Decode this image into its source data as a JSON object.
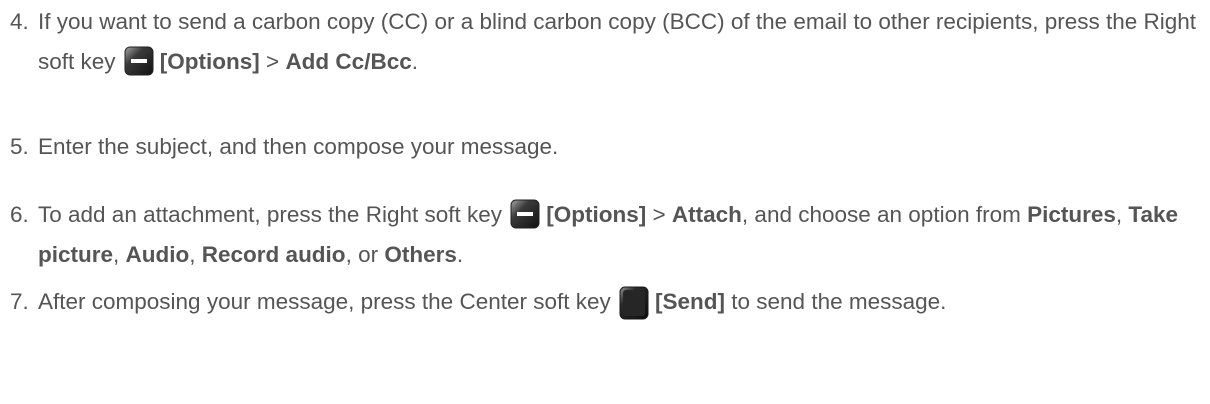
{
  "steps": [
    {
      "num": "4.",
      "t1": "If you want to send a carbon copy (CC) or a blind carbon copy (BCC) of the email to other recipients, press the Right soft key ",
      "key_icon": "right-soft-key-icon",
      "b1": "[Options]",
      "t2": " > ",
      "b2": "Add Cc/Bcc",
      "t3": "."
    },
    {
      "num": "5.",
      "text": "Enter the subject, and then compose your message."
    },
    {
      "num": "6.",
      "t1": "To add an attachment, press the Right soft key ",
      "key_icon": "right-soft-key-icon",
      "b1": "[Options]",
      "t2": " > ",
      "b2": "Attach",
      "t3": ", and choose an option from ",
      "b3": "Pictures",
      "t4": ", ",
      "b4": "Take picture",
      "t5": ", ",
      "b5": "Audio",
      "t6": ", ",
      "b6": "Record audio",
      "t7": ", or ",
      "b7": "Others",
      "t8": "."
    },
    {
      "num": "7.",
      "t1": "After composing your message, press the Center soft key ",
      "key_icon": "center-soft-key-icon",
      "b1": "[Send]",
      "t2": " to send the message."
    }
  ],
  "colors": {
    "text": "#555555",
    "key_dark": "#1e1e1e",
    "key_light": "#9a9a9a"
  }
}
